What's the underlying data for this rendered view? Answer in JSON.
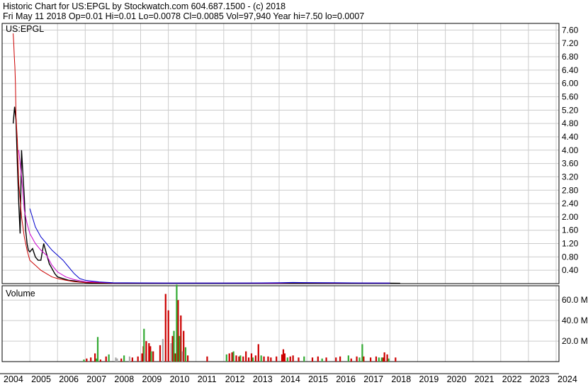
{
  "header": {
    "line1": "Historic Chart for US:EPGL by Stockwatch.com 604.687.1500 - (c) 2018",
    "line2": "Fri May 11 2018   Op=0.01   Hi=0.01   Lo=0.0078   Cl=0.0085   Vol=97,940   Year hi=7.50   lo=0.0007"
  },
  "chart_data": [
    {
      "type": "line",
      "title": "US:EPGL",
      "x_ticks": [
        "2004",
        "2005",
        "2006",
        "2007",
        "2008",
        "2009",
        "2010",
        "2011",
        "2012",
        "2013",
        "2014",
        "2015",
        "2016",
        "2017",
        "2018",
        "2019",
        "2020",
        "2021",
        "2022",
        "2023",
        "2024"
      ],
      "ylim": [
        0,
        7.8
      ],
      "y_ticks": [
        "0.40",
        "0.80",
        "1.20",
        "1.60",
        "2.00",
        "2.40",
        "2.80",
        "3.20",
        "3.60",
        "4.00",
        "4.40",
        "4.80",
        "5.20",
        "5.60",
        "6.00",
        "6.40",
        "6.80",
        "7.20",
        "7.60"
      ],
      "grid": true,
      "series": [
        {
          "color": "#000000",
          "x": [
            2004.4,
            2004.45,
            2004.5,
            2004.55,
            2004.6,
            2004.65,
            2004.7,
            2004.75,
            2004.8,
            2004.85,
            2004.9,
            2004.95,
            2005.0,
            2005.1,
            2005.2,
            2005.3,
            2005.4,
            2005.5,
            2005.6,
            2005.7,
            2005.8,
            2005.9,
            2006.0,
            2006.2,
            2006.4,
            2006.6,
            2006.8,
            2007.0,
            2007.5,
            2008.0,
            2009.0,
            2010.0,
            2011.0,
            2012.0,
            2013.0,
            2014.0,
            2014.5,
            2015.0,
            2016.0,
            2017.0,
            2018.0,
            2018.37
          ],
          "values": [
            4.8,
            5.3,
            4.9,
            3.6,
            2.4,
            1.5,
            4.0,
            3.3,
            2.6,
            1.6,
            1.2,
            1.0,
            0.95,
            1.05,
            0.8,
            0.7,
            0.7,
            1.2,
            0.9,
            0.6,
            0.45,
            0.3,
            0.2,
            0.15,
            0.1,
            0.08,
            0.05,
            0.03,
            0.02,
            0.015,
            0.01,
            0.01,
            0.01,
            0.01,
            0.012,
            0.012,
            0.02,
            0.015,
            0.015,
            0.012,
            0.01,
            0.0085
          ]
        },
        {
          "color": "#cc0000",
          "x": [
            2004.4,
            2004.42,
            2004.44,
            2004.46,
            2004.48,
            2004.5,
            2004.55,
            2004.6,
            2004.7,
            2004.8,
            2004.9,
            2005.0,
            2005.2,
            2005.4,
            2005.6,
            2005.8,
            2006.0,
            2006.3,
            2006.6,
            2007.0,
            2008.0
          ],
          "values": [
            7.5,
            7.2,
            6.8,
            6.5,
            6.0,
            5.0,
            4.3,
            3.0,
            2.0,
            1.4,
            1.0,
            0.7,
            0.55,
            0.4,
            0.3,
            0.2,
            0.15,
            0.1,
            0.06,
            0.03,
            0.02
          ]
        },
        {
          "color": "#cc00cc",
          "x": [
            2004.6,
            2004.7,
            2004.8,
            2004.9,
            2005.0,
            2005.2,
            2005.4,
            2005.6,
            2005.8,
            2006.0,
            2006.3,
            2006.6,
            2007.0,
            2008.0,
            2010.0,
            2012.0,
            2014.0,
            2014.5,
            2016.0,
            2018.0
          ],
          "values": [
            4.0,
            3.2,
            2.2,
            1.8,
            1.5,
            1.2,
            1.0,
            0.85,
            0.55,
            0.35,
            0.2,
            0.12,
            0.06,
            0.02,
            0.012,
            0.012,
            0.014,
            0.03,
            0.02,
            0.012
          ]
        },
        {
          "color": "#0000cc",
          "x": [
            2005.0,
            2005.2,
            2005.4,
            2005.6,
            2005.8,
            2006.0,
            2006.2,
            2006.4,
            2006.6,
            2006.8,
            2007.0,
            2007.5,
            2008.0,
            2010.0,
            2012.0,
            2013.0,
            2014.0,
            2014.5,
            2015.0,
            2016.0,
            2017.0,
            2018.0
          ],
          "values": [
            2.25,
            1.7,
            1.4,
            1.2,
            1.0,
            0.85,
            0.7,
            0.5,
            0.3,
            0.15,
            0.1,
            0.05,
            0.025,
            0.015,
            0.015,
            0.02,
            0.025,
            0.035,
            0.03,
            0.025,
            0.02,
            0.015
          ]
        }
      ]
    },
    {
      "type": "bar",
      "title": "Volume",
      "ylim": [
        0,
        74
      ],
      "y_ticks": [
        "20.0 M",
        "40.0 M",
        "60.0 M"
      ],
      "y_tick_values": [
        20,
        40,
        60
      ],
      "unit": "M",
      "series": [
        {
          "color": "#cc0000",
          "x": [
            2007.05,
            2007.2,
            2007.35,
            2007.55,
            2007.75,
            2008.3,
            2008.7,
            2008.9,
            2009.05,
            2009.1,
            2009.2,
            2009.3,
            2009.35,
            2009.45,
            2009.7,
            2009.9,
            2010.0,
            2010.15,
            2010.25,
            2010.35,
            2010.45,
            2010.55,
            2010.7,
            2011.4,
            2012.2,
            2012.3,
            2012.45,
            2012.55,
            2012.7,
            2012.8,
            2012.9,
            2013.0,
            2013.15,
            2013.25,
            2013.45,
            2013.6,
            2013.7,
            2013.9,
            2014.1,
            2014.15,
            2014.2,
            2014.4,
            2014.5,
            2014.7,
            2015.2,
            2015.4,
            2015.7,
            2016.05,
            2016.2,
            2016.6,
            2016.8,
            2017.05,
            2017.3,
            2017.5,
            2017.75,
            2017.8,
            2017.9,
            2018.2
          ],
          "values": [
            3,
            4,
            8,
            2,
            5,
            3,
            4,
            5,
            8,
            15,
            20,
            18,
            15,
            10,
            16,
            66,
            50,
            25,
            8,
            60,
            45,
            30,
            6,
            5,
            8,
            9,
            6,
            5,
            5,
            10,
            4,
            8,
            6,
            17,
            5,
            5,
            4,
            5,
            7,
            12,
            8,
            5,
            6,
            4,
            4,
            5,
            4,
            4,
            5,
            3,
            5,
            5,
            4,
            5,
            4,
            9,
            7,
            4
          ]
        },
        {
          "color": "#33aa33",
          "x": [
            2006.95,
            2007.4,
            2007.45,
            2007.85,
            2008.4,
            2009.12,
            2009.38,
            2010.2,
            2010.3,
            2010.4,
            2010.62,
            2012.1,
            2012.35,
            2012.6,
            2013.05,
            2013.35,
            2014.3,
            2014.9,
            2015.55,
            2016.5,
            2016.9,
            2017.0,
            2017.6,
            2017.7,
            2017.95
          ],
          "values": [
            2,
            3,
            24,
            7,
            6,
            32,
            10,
            30,
            75,
            25,
            14,
            7,
            10,
            6,
            4,
            6,
            4,
            5,
            3,
            6,
            4,
            17,
            4,
            4,
            3
          ]
        },
        {
          "color": "#aaaaaa",
          "x": [
            2008.1,
            2008.15,
            2008.6,
            2009.15,
            2009.8,
            2010.1,
            2010.5
          ],
          "values": [
            4,
            3,
            5,
            8,
            22,
            18,
            10
          ]
        }
      ]
    }
  ]
}
